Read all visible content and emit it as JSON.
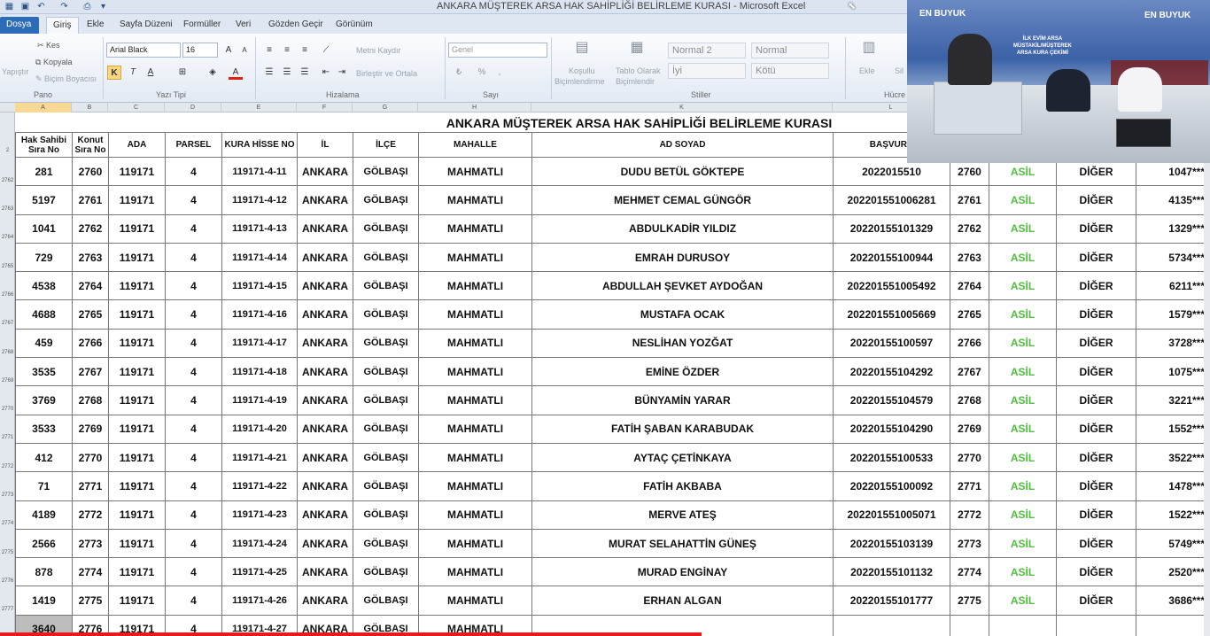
{
  "window": {
    "title": "ANKARA MÜŞTEREK ARSA HAK SAHİPLİĞİ BELİRLEME KURASI  -  Microsoft Excel"
  },
  "ribbon_tabs": [
    "Dosya",
    "Giriş",
    "Ekle",
    "Sayfa Düzeni",
    "Formüller",
    "Veri",
    "Gözden Geçir",
    "Görünüm"
  ],
  "ribbon": {
    "paste": "Yapıştır",
    "cut": "Kes",
    "copy": "Kopyala",
    "format_painter": "Biçim Boyacısı",
    "group_clipboard": "Pano",
    "font_name": "Arial Black",
    "font_size": "16",
    "group_font": "Yazı Tipi",
    "wrap_text": "Metni Kaydır",
    "merge_center": "Birleştir ve Ortala",
    "group_alignment": "Hizalama",
    "number_format": "Genel",
    "group_number": "Sayı",
    "cond_format_1": "Koşullu",
    "cond_format_2": "Biçimlendirme",
    "format_table_1": "Tablo Olarak",
    "format_table_2": "Biçimlendir",
    "style_normal2": "Normal 2",
    "style_normal": "Normal",
    "style_iyi": "İyi",
    "style_kotu": "Kötü",
    "group_styles": "Stiller",
    "insert": "Ekle",
    "delete": "Sil",
    "group_cells": "Hücre"
  },
  "columns": [
    "A",
    "B",
    "C",
    "D",
    "E",
    "F",
    "G",
    "H",
    "K",
    "L"
  ],
  "row_numbers": [
    "2",
    "2762",
    "2763",
    "2764",
    "2765",
    "2766",
    "2767",
    "2768",
    "2769",
    "2770",
    "2771",
    "2772",
    "2773",
    "2774",
    "2775",
    "2776",
    "2777"
  ],
  "sheet_title": "ANKARA MÜŞTEREK ARSA HAK SAHİPLİĞİ BELİRLEME KURASI",
  "headers": {
    "a1": "Hak Sahibi",
    "a2": "Sıra No",
    "b1": "Konut",
    "b2": "Sıra No",
    "c": "ADA",
    "d": "PARSEL",
    "e": "KURA HİSSE NO",
    "f": "İL",
    "g": "İLÇE",
    "h": "MAHALLE",
    "k": "AD SOYAD",
    "l": "BAŞVURU"
  },
  "rows": [
    {
      "hak": "281",
      "konut": "2760",
      "ada": "119171",
      "parsel": "4",
      "kura": "119171-4-11",
      "il": "ANKARA",
      "ilce": "GÖLBAŞI",
      "mahalle": "MAHMATLI",
      "ad": "DUDU BETÜL GÖKTEPE",
      "basvuru": "2022015510",
      "konut2": "2760",
      "durum": "ASİL",
      "tur": "DİĞER",
      "tc": "1047***"
    },
    {
      "hak": "5197",
      "konut": "2761",
      "ada": "119171",
      "parsel": "4",
      "kura": "119171-4-12",
      "il": "ANKARA",
      "ilce": "GÖLBAŞI",
      "mahalle": "MAHMATLI",
      "ad": "MEHMET CEMAL GÜNGÖR",
      "basvuru": "202201551006281",
      "konut2": "2761",
      "durum": "ASİL",
      "tur": "DİĞER",
      "tc": "4135***"
    },
    {
      "hak": "1041",
      "konut": "2762",
      "ada": "119171",
      "parsel": "4",
      "kura": "119171-4-13",
      "il": "ANKARA",
      "ilce": "GÖLBAŞI",
      "mahalle": "MAHMATLI",
      "ad": "ABDULKADİR YILDIZ",
      "basvuru": "20220155101329",
      "konut2": "2762",
      "durum": "ASİL",
      "tur": "DİĞER",
      "tc": "1329***"
    },
    {
      "hak": "729",
      "konut": "2763",
      "ada": "119171",
      "parsel": "4",
      "kura": "119171-4-14",
      "il": "ANKARA",
      "ilce": "GÖLBAŞI",
      "mahalle": "MAHMATLI",
      "ad": "EMRAH DURUSOY",
      "basvuru": "20220155100944",
      "konut2": "2763",
      "durum": "ASİL",
      "tur": "DİĞER",
      "tc": "5734***"
    },
    {
      "hak": "4538",
      "konut": "2764",
      "ada": "119171",
      "parsel": "4",
      "kura": "119171-4-15",
      "il": "ANKARA",
      "ilce": "GÖLBAŞI",
      "mahalle": "MAHMATLI",
      "ad": "ABDULLAH ŞEVKET AYDOĞAN",
      "basvuru": "202201551005492",
      "konut2": "2764",
      "durum": "ASİL",
      "tur": "DİĞER",
      "tc": "6211***"
    },
    {
      "hak": "4688",
      "konut": "2765",
      "ada": "119171",
      "parsel": "4",
      "kura": "119171-4-16",
      "il": "ANKARA",
      "ilce": "GÖLBAŞI",
      "mahalle": "MAHMATLI",
      "ad": "MUSTAFA OCAK",
      "basvuru": "202201551005669",
      "konut2": "2765",
      "durum": "ASİL",
      "tur": "DİĞER",
      "tc": "1579***"
    },
    {
      "hak": "459",
      "konut": "2766",
      "ada": "119171",
      "parsel": "4",
      "kura": "119171-4-17",
      "il": "ANKARA",
      "ilce": "GÖLBAŞI",
      "mahalle": "MAHMATLI",
      "ad": "NESLİHAN YOZĞAT",
      "basvuru": "20220155100597",
      "konut2": "2766",
      "durum": "ASİL",
      "tur": "DİĞER",
      "tc": "3728***"
    },
    {
      "hak": "3535",
      "konut": "2767",
      "ada": "119171",
      "parsel": "4",
      "kura": "119171-4-18",
      "il": "ANKARA",
      "ilce": "GÖLBAŞI",
      "mahalle": "MAHMATLI",
      "ad": "EMİNE ÖZDER",
      "basvuru": "20220155104292",
      "konut2": "2767",
      "durum": "ASİL",
      "tur": "DİĞER",
      "tc": "1075***"
    },
    {
      "hak": "3769",
      "konut": "2768",
      "ada": "119171",
      "parsel": "4",
      "kura": "119171-4-19",
      "il": "ANKARA",
      "ilce": "GÖLBAŞI",
      "mahalle": "MAHMATLI",
      "ad": "BÜNYAMİN YARAR",
      "basvuru": "20220155104579",
      "konut2": "2768",
      "durum": "ASİL",
      "tur": "DİĞER",
      "tc": "3221***"
    },
    {
      "hak": "3533",
      "konut": "2769",
      "ada": "119171",
      "parsel": "4",
      "kura": "119171-4-20",
      "il": "ANKARA",
      "ilce": "GÖLBAŞI",
      "mahalle": "MAHMATLI",
      "ad": "FATİH ŞABAN KARABUDAK",
      "basvuru": "20220155104290",
      "konut2": "2769",
      "durum": "ASİL",
      "tur": "DİĞER",
      "tc": "1552***"
    },
    {
      "hak": "412",
      "konut": "2770",
      "ada": "119171",
      "parsel": "4",
      "kura": "119171-4-21",
      "il": "ANKARA",
      "ilce": "GÖLBAŞI",
      "mahalle": "MAHMATLI",
      "ad": "AYTAÇ ÇETİNKAYA",
      "basvuru": "20220155100533",
      "konut2": "2770",
      "durum": "ASİL",
      "tur": "DİĞER",
      "tc": "3522***"
    },
    {
      "hak": "71",
      "konut": "2771",
      "ada": "119171",
      "parsel": "4",
      "kura": "119171-4-22",
      "il": "ANKARA",
      "ilce": "GÖLBAŞI",
      "mahalle": "MAHMATLI",
      "ad": "FATİH AKBABA",
      "basvuru": "20220155100092",
      "konut2": "2771",
      "durum": "ASİL",
      "tur": "DİĞER",
      "tc": "1478***"
    },
    {
      "hak": "4189",
      "konut": "2772",
      "ada": "119171",
      "parsel": "4",
      "kura": "119171-4-23",
      "il": "ANKARA",
      "ilce": "GÖLBAŞI",
      "mahalle": "MAHMATLI",
      "ad": "MERVE ATEŞ",
      "basvuru": "202201551005071",
      "konut2": "2772",
      "durum": "ASİL",
      "tur": "DİĞER",
      "tc": "1522***"
    },
    {
      "hak": "2566",
      "konut": "2773",
      "ada": "119171",
      "parsel": "4",
      "kura": "119171-4-24",
      "il": "ANKARA",
      "ilce": "GÖLBAŞI",
      "mahalle": "MAHMATLI",
      "ad": "MURAT SELAHATTİN GÜNEŞ",
      "basvuru": "20220155103139",
      "konut2": "2773",
      "durum": "ASİL",
      "tur": "DİĞER",
      "tc": "5749***"
    },
    {
      "hak": "878",
      "konut": "2774",
      "ada": "119171",
      "parsel": "4",
      "kura": "119171-4-25",
      "il": "ANKARA",
      "ilce": "GÖLBAŞI",
      "mahalle": "MAHMATLI",
      "ad": "MURAD ENGİNAY",
      "basvuru": "20220155101132",
      "konut2": "2774",
      "durum": "ASİL",
      "tur": "DİĞER",
      "tc": "2520***"
    },
    {
      "hak": "1419",
      "konut": "2775",
      "ada": "119171",
      "parsel": "4",
      "kura": "119171-4-26",
      "il": "ANKARA",
      "ilce": "GÖLBAŞI",
      "mahalle": "MAHMATLI",
      "ad": "ERHAN ALGAN",
      "basvuru": "20220155101777",
      "konut2": "2775",
      "durum": "ASİL",
      "tur": "DİĞER",
      "tc": "3686***"
    },
    {
      "hak": "3640",
      "konut": "2776",
      "ada": "119171",
      "parsel": "4",
      "kura": "119171-4-27",
      "il": "ANKARA",
      "ilce": "GÖLBAŞI",
      "mahalle": "MAHMATLI",
      "ad": "",
      "basvuru": "",
      "konut2": "",
      "durum": "",
      "tur": "",
      "tc": ""
    }
  ],
  "video_overlay": {
    "left_1": "EN BUYUK",
    "left_2": "",
    "right_1": "EN BUYUK",
    "right_2": "",
    "center_1": "İLK EVİM ARSA",
    "center_2": "MÜSTAKİL/MÜŞTEREK",
    "center_3": "ARSA KURA ÇEKİMİ"
  },
  "colors": {
    "accent": "#2c6bb7",
    "asil": "#4fbf3a",
    "video_progress": "#e8181b"
  },
  "icons": [
    "save-icon",
    "undo-icon",
    "redo-icon",
    "cursor-icon",
    "scissors-icon",
    "copy-icon",
    "brush-icon"
  ],
  "video": {
    "progress_pct": 58
  }
}
